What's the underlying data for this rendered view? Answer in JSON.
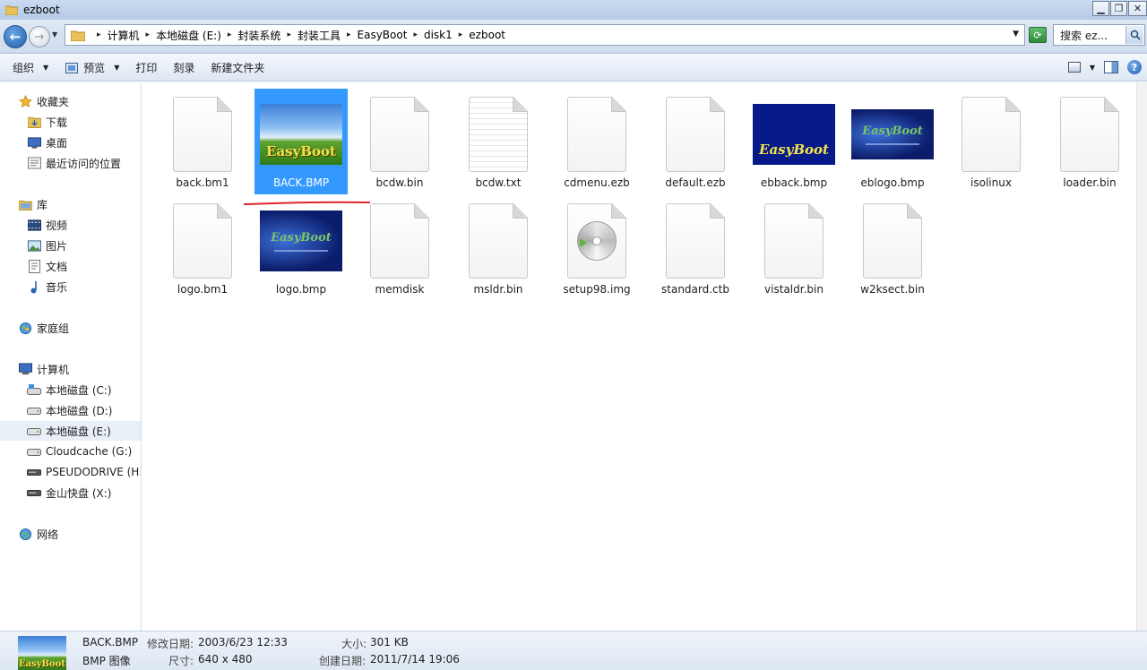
{
  "window": {
    "title": "ezboot"
  },
  "address": {
    "crumbs": [
      "计算机",
      "本地磁盘 (E:)",
      "封装系统",
      "封装工具",
      "EasyBoot",
      "disk1",
      "ezboot"
    ],
    "search_placeholder": "搜索 ez..."
  },
  "toolbar": {
    "organize": "组织",
    "preview": "预览",
    "print": "打印",
    "burn": "刻录",
    "new_folder": "新建文件夹"
  },
  "nav": {
    "favorites": "收藏夹",
    "downloads": "下载",
    "desktop": "桌面",
    "recent": "最近访问的位置",
    "libraries": "库",
    "videos": "视频",
    "pictures": "图片",
    "documents": "文档",
    "music": "音乐",
    "homegroup": "家庭组",
    "computer": "计算机",
    "drive_c": "本地磁盘 (C:)",
    "drive_d": "本地磁盘 (D:)",
    "drive_e": "本地磁盘 (E:)",
    "drive_g": "Cloudcache (G:)",
    "drive_h": "PSEUDODRIVE (H:",
    "drive_x": "金山快盘 (X:)",
    "network": "网络"
  },
  "files": [
    {
      "name": "back.bm1"
    },
    {
      "name": "BACK.BMP",
      "thumb_text": "EasyBoot"
    },
    {
      "name": "bcdw.bin"
    },
    {
      "name": "bcdw.txt"
    },
    {
      "name": "cdmenu.ezb"
    },
    {
      "name": "default.ezb"
    },
    {
      "name": "ebback.bmp",
      "thumb_text": "EasyBoot"
    },
    {
      "name": "eblogo.bmp",
      "thumb_text": "EasyBoot"
    },
    {
      "name": "isolinux"
    },
    {
      "name": "loader.bin"
    },
    {
      "name": "logo.bm1"
    },
    {
      "name": "logo.bmp",
      "thumb_text": "EasyBoot"
    },
    {
      "name": "memdisk"
    },
    {
      "name": "msldr.bin"
    },
    {
      "name": "setup98.img"
    },
    {
      "name": "standard.ctb"
    },
    {
      "name": "vistaldr.bin"
    },
    {
      "name": "w2ksect.bin"
    }
  ],
  "details": {
    "name": "BACK.BMP",
    "type": "BMP 图像",
    "modified_label": "修改日期:",
    "modified": "2003/6/23 12:33",
    "dimensions_label": "尺寸:",
    "dimensions": "640 x 480",
    "size_label": "大小:",
    "size": "301 KB",
    "created_label": "创建日期:",
    "created": "2011/7/14 19:06",
    "thumb_text": "EasyBoot"
  },
  "colors": {
    "selection": "#3399ff",
    "annotation": "#e0242b",
    "accent": "#1f5ea8"
  }
}
